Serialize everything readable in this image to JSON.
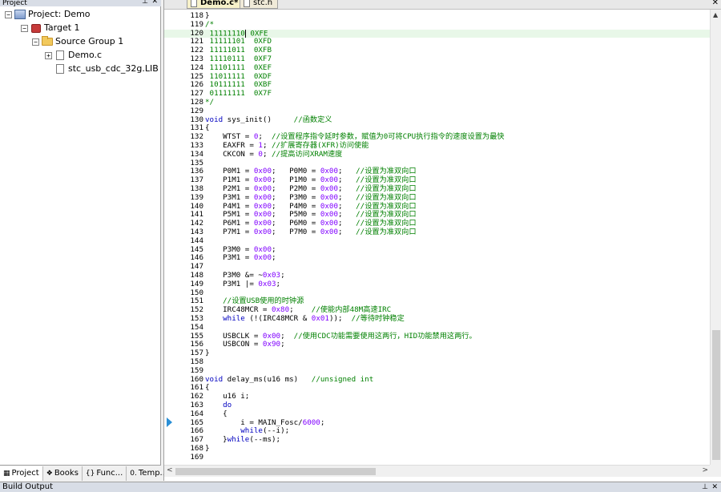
{
  "project_panel": {
    "title": "Project",
    "tree": [
      {
        "label": "Project: Demo",
        "icon": "project-icon",
        "indent": 0,
        "expander": "−"
      },
      {
        "label": "Target 1",
        "icon": "target-icon",
        "indent": 1,
        "expander": "−"
      },
      {
        "label": "Source Group 1",
        "icon": "folder-icon",
        "indent": 2,
        "expander": "−"
      },
      {
        "label": "Demo.c",
        "icon": "file-icon",
        "indent": 3,
        "expander": "+"
      },
      {
        "label": "stc_usb_cdc_32g.LIB",
        "icon": "file-icon",
        "indent": 3,
        "expander": ""
      }
    ],
    "tabs": [
      {
        "label": "Project",
        "icon": "project-tab-icon"
      },
      {
        "label": "Books",
        "icon": "books-icon"
      },
      {
        "label": "Func...",
        "icon": "functions-icon"
      },
      {
        "label": "Temp...",
        "icon": "templates-icon"
      }
    ]
  },
  "editor": {
    "tabs": [
      {
        "label": "Demo.c*",
        "active": true
      },
      {
        "label": "stc.h",
        "active": false
      }
    ],
    "current_line": 120,
    "exec_line": 165,
    "lines": [
      {
        "n": "118",
        "segs": [
          [
            "}",
            ""
          ]
        ]
      },
      {
        "n": "119",
        "segs": [
          [
            "/*",
            "cmt"
          ]
        ]
      },
      {
        "n": "120",
        "segs": [
          [
            " 11111110",
            "cmt"
          ],
          [
            "|",
            "caret"
          ],
          [
            " 0XFE",
            "cmt"
          ]
        ]
      },
      {
        "n": "121",
        "segs": [
          [
            " 11111101  0XFD",
            "cmt"
          ]
        ]
      },
      {
        "n": "122",
        "segs": [
          [
            " 11111011  0XFB",
            "cmt"
          ]
        ]
      },
      {
        "n": "123",
        "segs": [
          [
            " 11110111  0XF7",
            "cmt"
          ]
        ]
      },
      {
        "n": "124",
        "segs": [
          [
            " 11101111  0XEF",
            "cmt"
          ]
        ]
      },
      {
        "n": "125",
        "segs": [
          [
            " 11011111  0XDF",
            "cmt"
          ]
        ]
      },
      {
        "n": "126",
        "segs": [
          [
            " 10111111  0XBF",
            "cmt"
          ]
        ]
      },
      {
        "n": "127",
        "segs": [
          [
            " 01111111  0X7F",
            "cmt"
          ]
        ]
      },
      {
        "n": "128",
        "segs": [
          [
            "*/",
            "cmt"
          ]
        ]
      },
      {
        "n": "129",
        "segs": [
          [
            "",
            ""
          ]
        ]
      },
      {
        "n": "130",
        "segs": [
          [
            "void",
            "kw"
          ],
          [
            " sys_init()     ",
            ""
          ],
          [
            "//函数定义",
            "cmt"
          ]
        ]
      },
      {
        "n": "131",
        "segs": [
          [
            "{",
            ""
          ]
        ]
      },
      {
        "n": "132",
        "segs": [
          [
            "    WTST = ",
            ""
          ],
          [
            "0",
            "num"
          ],
          [
            ";  ",
            ""
          ],
          [
            "//设置程序指令延时参数，赋值为0可将CPU执行指令的速度设置为最快",
            "cmt"
          ]
        ]
      },
      {
        "n": "133",
        "segs": [
          [
            "    EAXFR = ",
            ""
          ],
          [
            "1",
            "num"
          ],
          [
            "; ",
            ""
          ],
          [
            "//扩展寄存器(XFR)访问使能",
            "cmt"
          ]
        ]
      },
      {
        "n": "134",
        "segs": [
          [
            "    CKCON = ",
            ""
          ],
          [
            "0",
            "num"
          ],
          [
            "; ",
            ""
          ],
          [
            "//提高访问XRAM速度",
            "cmt"
          ]
        ]
      },
      {
        "n": "135",
        "segs": [
          [
            "",
            ""
          ]
        ]
      },
      {
        "n": "136",
        "segs": [
          [
            "    P0M1 = ",
            ""
          ],
          [
            "0x00",
            "num"
          ],
          [
            ";   P0M0 = ",
            ""
          ],
          [
            "0x00",
            "num"
          ],
          [
            ";   ",
            ""
          ],
          [
            "//设置为准双向口",
            "cmt"
          ]
        ]
      },
      {
        "n": "137",
        "segs": [
          [
            "    P1M1 = ",
            ""
          ],
          [
            "0x00",
            "num"
          ],
          [
            ";   P1M0 = ",
            ""
          ],
          [
            "0x00",
            "num"
          ],
          [
            ";   ",
            ""
          ],
          [
            "//设置为准双向口",
            "cmt"
          ]
        ]
      },
      {
        "n": "138",
        "segs": [
          [
            "    P2M1 = ",
            ""
          ],
          [
            "0x00",
            "num"
          ],
          [
            ";   P2M0 = ",
            ""
          ],
          [
            "0x00",
            "num"
          ],
          [
            ";   ",
            ""
          ],
          [
            "//设置为准双向口",
            "cmt"
          ]
        ]
      },
      {
        "n": "139",
        "segs": [
          [
            "    P3M1 = ",
            ""
          ],
          [
            "0x00",
            "num"
          ],
          [
            ";   P3M0 = ",
            ""
          ],
          [
            "0x00",
            "num"
          ],
          [
            ";   ",
            ""
          ],
          [
            "//设置为准双向口",
            "cmt"
          ]
        ]
      },
      {
        "n": "140",
        "segs": [
          [
            "    P4M1 = ",
            ""
          ],
          [
            "0x00",
            "num"
          ],
          [
            ";   P4M0 = ",
            ""
          ],
          [
            "0x00",
            "num"
          ],
          [
            ";   ",
            ""
          ],
          [
            "//设置为准双向口",
            "cmt"
          ]
        ]
      },
      {
        "n": "141",
        "segs": [
          [
            "    P5M1 = ",
            ""
          ],
          [
            "0x00",
            "num"
          ],
          [
            ";   P5M0 = ",
            ""
          ],
          [
            "0x00",
            "num"
          ],
          [
            ";   ",
            ""
          ],
          [
            "//设置为准双向口",
            "cmt"
          ]
        ]
      },
      {
        "n": "142",
        "segs": [
          [
            "    P6M1 = ",
            ""
          ],
          [
            "0x00",
            "num"
          ],
          [
            ";   P6M0 = ",
            ""
          ],
          [
            "0x00",
            "num"
          ],
          [
            ";   ",
            ""
          ],
          [
            "//设置为准双向口",
            "cmt"
          ]
        ]
      },
      {
        "n": "143",
        "segs": [
          [
            "    P7M1 = ",
            ""
          ],
          [
            "0x00",
            "num"
          ],
          [
            ";   P7M0 = ",
            ""
          ],
          [
            "0x00",
            "num"
          ],
          [
            ";   ",
            ""
          ],
          [
            "//设置为准双向口",
            "cmt"
          ]
        ]
      },
      {
        "n": "144",
        "segs": [
          [
            "",
            ""
          ]
        ]
      },
      {
        "n": "145",
        "segs": [
          [
            "    P3M0 = ",
            ""
          ],
          [
            "0x00",
            "num"
          ],
          [
            ";",
            ""
          ]
        ]
      },
      {
        "n": "146",
        "segs": [
          [
            "    P3M1 = ",
            ""
          ],
          [
            "0x00",
            "num"
          ],
          [
            ";",
            ""
          ]
        ]
      },
      {
        "n": "147",
        "segs": [
          [
            "",
            ""
          ]
        ]
      },
      {
        "n": "148",
        "segs": [
          [
            "    P3M0 &= ~",
            ""
          ],
          [
            "0x03",
            "num"
          ],
          [
            ";",
            ""
          ]
        ]
      },
      {
        "n": "149",
        "segs": [
          [
            "    P3M1 |= ",
            ""
          ],
          [
            "0x03",
            "num"
          ],
          [
            ";",
            ""
          ]
        ]
      },
      {
        "n": "150",
        "segs": [
          [
            "",
            ""
          ]
        ]
      },
      {
        "n": "151",
        "segs": [
          [
            "    ",
            ""
          ],
          [
            "//设置USB使用的时钟源",
            "cmt"
          ]
        ]
      },
      {
        "n": "152",
        "segs": [
          [
            "    IRC48MCR = ",
            ""
          ],
          [
            "0x80",
            "num"
          ],
          [
            ";    ",
            ""
          ],
          [
            "//使能内部48M高速IRC",
            "cmt"
          ]
        ]
      },
      {
        "n": "153",
        "segs": [
          [
            "    ",
            ""
          ],
          [
            "while",
            "kw"
          ],
          [
            " (!(IRC48MCR & ",
            ""
          ],
          [
            "0x01",
            "num"
          ],
          [
            "));  ",
            ""
          ],
          [
            "//等待时钟稳定",
            "cmt"
          ]
        ]
      },
      {
        "n": "154",
        "segs": [
          [
            "",
            ""
          ]
        ]
      },
      {
        "n": "155",
        "segs": [
          [
            "    USBCLK = ",
            ""
          ],
          [
            "0x00",
            "num"
          ],
          [
            ";  ",
            ""
          ],
          [
            "//使用CDC功能需要使用这两行，HID功能禁用这两行。",
            "cmt"
          ]
        ]
      },
      {
        "n": "156",
        "segs": [
          [
            "    USBCON = ",
            ""
          ],
          [
            "0x90",
            "num"
          ],
          [
            ";",
            ""
          ]
        ]
      },
      {
        "n": "157",
        "segs": [
          [
            "}",
            ""
          ]
        ]
      },
      {
        "n": "158",
        "segs": [
          [
            "",
            ""
          ]
        ]
      },
      {
        "n": "159",
        "segs": [
          [
            "",
            ""
          ]
        ]
      },
      {
        "n": "160",
        "segs": [
          [
            "void",
            "kw"
          ],
          [
            " delay_ms(u16 ms)   ",
            ""
          ],
          [
            "//unsigned int",
            "cmt"
          ]
        ]
      },
      {
        "n": "161",
        "segs": [
          [
            "{",
            ""
          ]
        ]
      },
      {
        "n": "162",
        "segs": [
          [
            "    u16 i;",
            ""
          ]
        ]
      },
      {
        "n": "163",
        "segs": [
          [
            "    ",
            ""
          ],
          [
            "do",
            "kw"
          ]
        ]
      },
      {
        "n": "164",
        "segs": [
          [
            "    {",
            ""
          ]
        ]
      },
      {
        "n": "165",
        "segs": [
          [
            "        i = MAIN_Fosc/",
            ""
          ],
          [
            "6000",
            "num"
          ],
          [
            ";",
            ""
          ]
        ]
      },
      {
        "n": "166",
        "segs": [
          [
            "        ",
            ""
          ],
          [
            "while",
            "kw"
          ],
          [
            "(--i);",
            ""
          ]
        ]
      },
      {
        "n": "167",
        "segs": [
          [
            "    }",
            ""
          ],
          [
            "while",
            "kw"
          ],
          [
            "(--ms);",
            ""
          ]
        ]
      },
      {
        "n": "168",
        "segs": [
          [
            "}",
            ""
          ]
        ]
      },
      {
        "n": "169",
        "segs": [
          [
            "",
            ""
          ]
        ]
      }
    ]
  },
  "build_output": {
    "title": "Build Output"
  }
}
